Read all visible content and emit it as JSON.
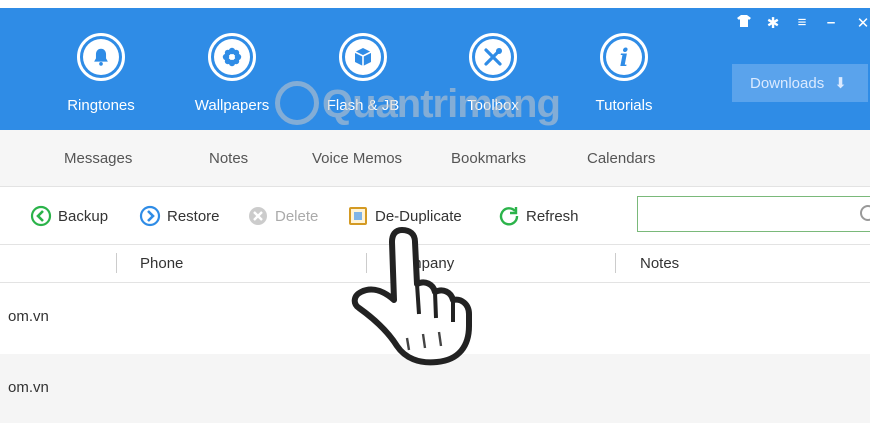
{
  "nav": {
    "items": [
      {
        "label": "Ringtones",
        "icon": "bell-icon"
      },
      {
        "label": "Wallpapers",
        "icon": "flower-icon"
      },
      {
        "label": "Flash & JB",
        "icon": "box-icon"
      },
      {
        "label": "Toolbox",
        "icon": "tools-icon"
      },
      {
        "label": "Tutorials",
        "icon": "info-icon"
      }
    ],
    "downloads_label": "Downloads",
    "window_controls": [
      "skin-icon",
      "settings-icon",
      "menu-icon",
      "minimize-icon",
      "close-icon"
    ]
  },
  "watermark": "Quantrimang",
  "tabs": {
    "partial": " ",
    "items": [
      "Messages",
      "Notes",
      "Voice Memos",
      "Bookmarks",
      "Calendars"
    ]
  },
  "toolbar": {
    "backup": "Backup",
    "restore": "Restore",
    "delete": "Delete",
    "deduplicate": "De-Duplicate",
    "refresh": "Refresh",
    "search_value": ""
  },
  "table": {
    "columns": [
      "Phone",
      "Company",
      "Notes"
    ],
    "rows": [
      {
        "email": "om.vn"
      },
      {
        "email": "om.vn"
      }
    ]
  },
  "colors": {
    "topbar": "#2f8ce6",
    "accent_green": "#2bb34a",
    "search_border": "#7ab97a"
  }
}
